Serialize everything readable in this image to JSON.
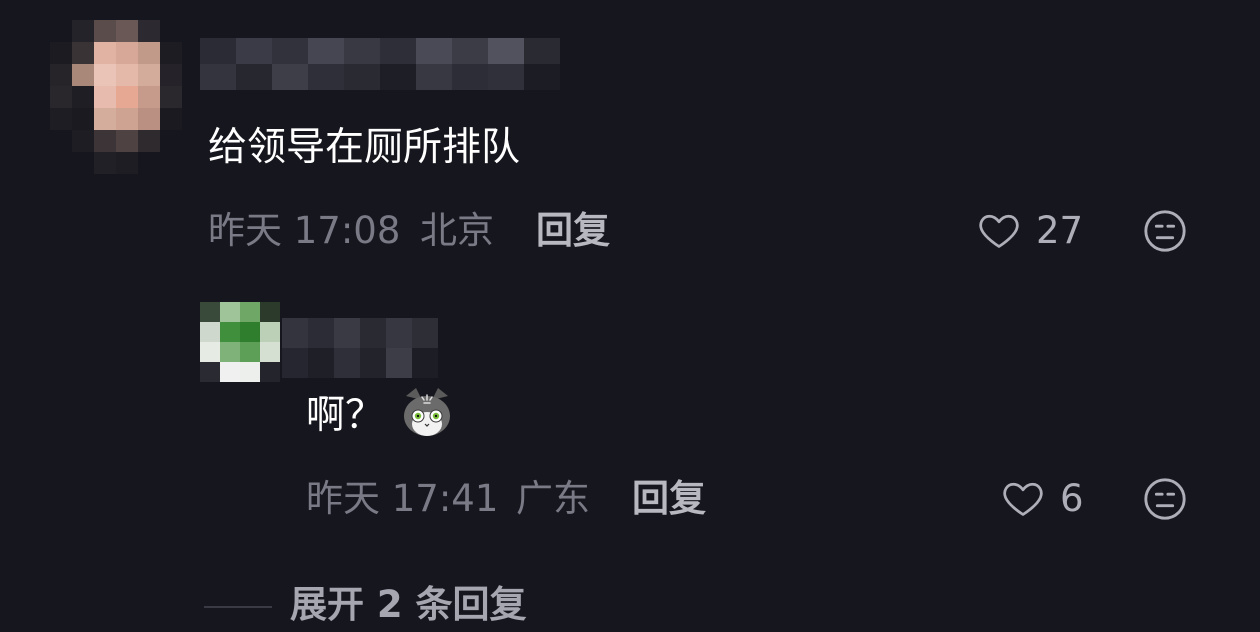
{
  "comment": {
    "text": "给领导在厕所排队",
    "time": "昨天 17:08",
    "location": "北京",
    "reply_label": "回复",
    "like_count": "27"
  },
  "reply": {
    "text": "啊？",
    "time": "昨天 17:41",
    "location": "广东",
    "reply_label": "回复",
    "like_count": "6"
  },
  "expand_label": "展开 2 条回复",
  "icons": {
    "like": "heart-outline-icon",
    "dislike": "meh-face-icon",
    "sticker": "cat-emoji-sticker"
  },
  "colors": {
    "background": "#16161e",
    "primary_text": "#ffffff",
    "secondary_text": "#7a7a86"
  }
}
